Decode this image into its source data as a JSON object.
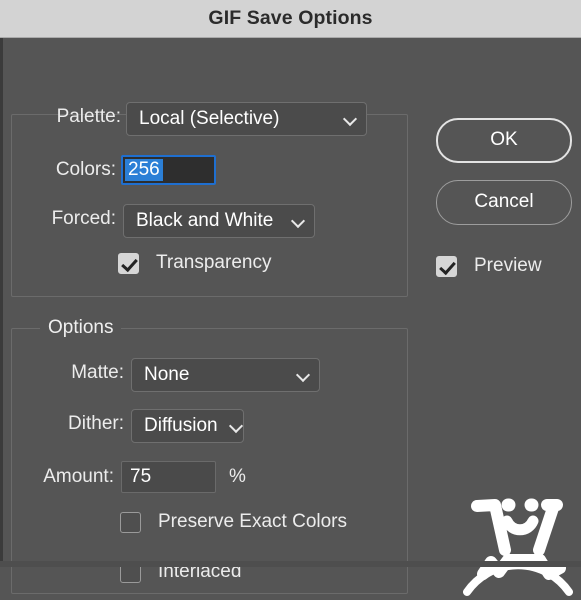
{
  "window": {
    "title": "GIF Save Options"
  },
  "palette_group": {
    "rows": {
      "palette_label": "Palette:",
      "palette_value": "Local (Selective)",
      "colors_label": "Colors:",
      "colors_value": "256",
      "forced_label": "Forced:",
      "forced_value": "Black and White",
      "transparency_label": "Transparency",
      "transparency_checked": true
    }
  },
  "options_group": {
    "legend": "Options",
    "rows": {
      "matte_label": "Matte:",
      "matte_value": "None",
      "dither_label": "Dither:",
      "dither_value": "Diffusion",
      "amount_label": "Amount:",
      "amount_value": "75",
      "amount_unit": "%",
      "preserve_label": "Preserve Exact Colors",
      "preserve_checked": false,
      "interlaced_label": "Interlaced",
      "interlaced_checked": false
    }
  },
  "actions": {
    "ok_label": "OK",
    "cancel_label": "Cancel",
    "preview_label": "Preview",
    "preview_checked": true
  },
  "colors": {
    "titlebar_bg": "#d3d3d3",
    "dialog_bg": "#555555",
    "control_bg": "#4b4b4b",
    "input_bg": "#303030",
    "text": "#ececec",
    "focus_ring": "#1f6fd0",
    "selection": "#2b7fd6",
    "checkbox_on_bg": "#d6d6d6",
    "group_border": "#6b6b6b"
  }
}
